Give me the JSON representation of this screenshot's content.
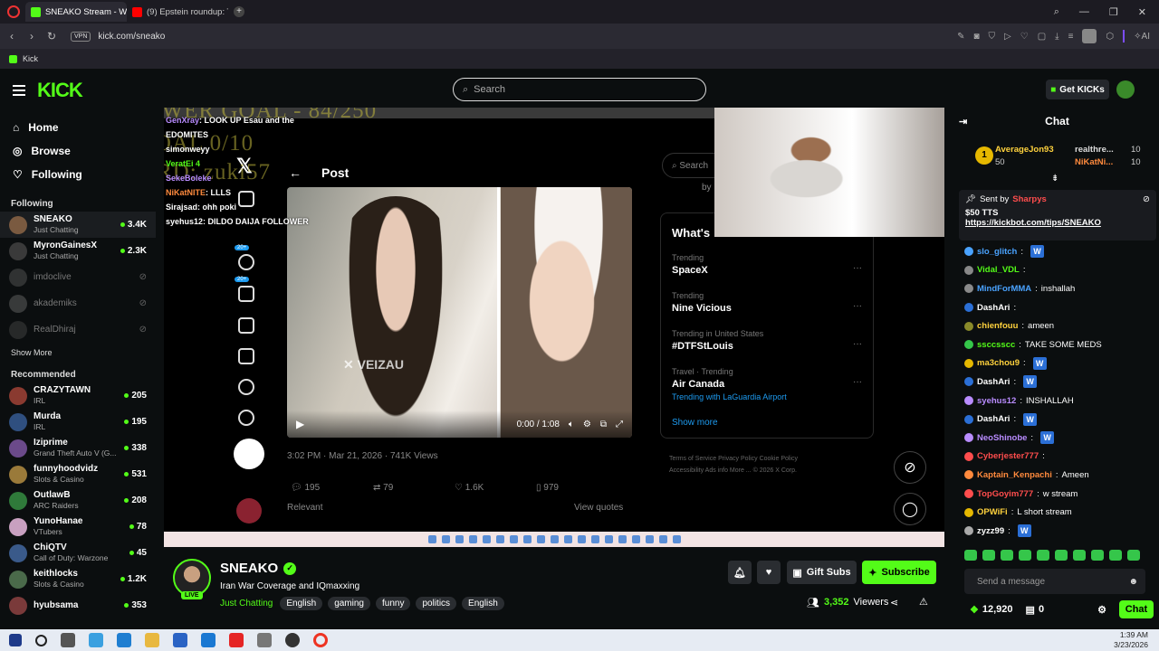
{
  "browser": {
    "tabs": [
      {
        "label": "SNEAKO Stream - Wa",
        "color": "#53fc18",
        "active": true
      },
      {
        "label": "(9) Epstein roundup: Trum",
        "color": "#ff0000",
        "active": false
      }
    ],
    "url": "kick.com/sneako",
    "vpn": "VPN",
    "bookmark": "Kick",
    "ai_label": "AI"
  },
  "header": {
    "logo": "KICK",
    "search_placeholder": "Search",
    "get_kicks": "Get KICKs"
  },
  "sidebar": {
    "nav": [
      {
        "label": "Home",
        "icon": "home-icon"
      },
      {
        "label": "Browse",
        "icon": "compass-icon"
      },
      {
        "label": "Following",
        "icon": "heart-icon"
      }
    ],
    "following_title": "Following",
    "following": [
      {
        "name": "SNEAKO",
        "sub": "Just Chatting",
        "viewers": "3.4K",
        "live": true
      },
      {
        "name": "MyronGainesX",
        "sub": "Just Chatting",
        "viewers": "2.3K",
        "live": true
      },
      {
        "name": "imdoclive",
        "sub": "",
        "viewers": "",
        "live": false
      },
      {
        "name": "akademiks",
        "sub": "",
        "viewers": "",
        "live": false
      },
      {
        "name": "RealDhiraj",
        "sub": "",
        "viewers": "",
        "live": false
      }
    ],
    "show_more": "Show More",
    "recommended_title": "Recommended",
    "recommended": [
      {
        "name": "CRAZYTAWN",
        "sub": "IRL",
        "viewers": "205"
      },
      {
        "name": "Murda",
        "sub": "IRL",
        "viewers": "195"
      },
      {
        "name": "Iziprime",
        "sub": "Grand Theft Auto V (G...",
        "viewers": "338"
      },
      {
        "name": "funnyhoodvidz",
        "sub": "Slots & Casino",
        "viewers": "531"
      },
      {
        "name": "OutlawB",
        "sub": "ARC Raiders",
        "viewers": "208"
      },
      {
        "name": "YunoHanae",
        "sub": "VTubers",
        "viewers": "78"
      },
      {
        "name": "ChiQTV",
        "sub": "Call of Duty: Warzone",
        "viewers": "45"
      },
      {
        "name": "keithlocks",
        "sub": "Slots & Casino",
        "viewers": "1.2K"
      },
      {
        "name": "hyubsama",
        "sub": "",
        "viewers": "353"
      }
    ]
  },
  "video": {
    "overlay": {
      "line1": "FOLLOWER GOAL - 84/250",
      "line2": "SUB GOAL 0/10",
      "line3": "DISCORD: zuki57"
    },
    "overlay_chat": [
      {
        "user": "GenXray",
        "text": "LOOK UP Esau and the",
        "color": "#b98cff"
      },
      {
        "user": "",
        "text": "EDOMITES",
        "color": "#fff"
      },
      {
        "user": "simonweyy",
        "text": "",
        "color": "#fff"
      },
      {
        "user": "VeratEi 4",
        "text": "",
        "color": "#53fc18"
      },
      {
        "user": "SekeBoleke",
        "text": "",
        "color": "#b98cff"
      },
      {
        "user": "NiKatNITE",
        "text": "LLLS",
        "color": "#ff8a3d"
      },
      {
        "user": "Sirajsad",
        "text": "ohh poki",
        "color": "#fff"
      },
      {
        "user": "syehus12",
        "text": "DILDO DAIJA FOLLOWER",
        "color": "#fff"
      }
    ],
    "post_title": "Post",
    "search_label": "Search",
    "x_search_sub": "by",
    "video_time": "0:00 / 1:08",
    "watermark": "VEIZAU",
    "post_meta": "3:02 PM · Mar 21, 2026 · 741K Views",
    "stats": {
      "replies": "195",
      "reposts": "79",
      "likes": "1.6K",
      "bookmarks": "979"
    },
    "relevant": "Relevant",
    "view_quotes": "View quotes",
    "whats_happening": "What's",
    "trends": [
      {
        "label": "Trending",
        "topic": "SpaceX",
        "extra": ""
      },
      {
        "label": "Trending",
        "topic": "Nine Vicious",
        "extra": ""
      },
      {
        "label": "Trending in United States",
        "topic": "#DTFStLouis",
        "extra": ""
      },
      {
        "label": "Travel · Trending",
        "topic": "Air Canada",
        "extra": "Trending with LaGuardia Airport"
      }
    ],
    "show_more": "Show more",
    "footer_links": "Terms of Service   Privacy Policy   Cookie Policy   Accessibility   Ads info   More ...   © 2026 X Corp.",
    "notif_badges": [
      "20+",
      "20+"
    ]
  },
  "stream": {
    "name": "SNEAKO",
    "live": "LIVE",
    "title": "Iran War Coverage and IQmaxxing",
    "category": "Just Chatting",
    "tags": [
      "English",
      "gaming",
      "funny",
      "politics",
      "English"
    ],
    "gift_subs": "Gift Subs",
    "subscribe": "Subscribe",
    "viewers": "3,352",
    "viewers_label": "Viewers"
  },
  "chat": {
    "title": "Chat",
    "leaderboard": [
      {
        "rank": "1",
        "user": "AverageJon93",
        "points": "50"
      },
      {
        "user": "realthre...",
        "points": "10"
      },
      {
        "user": "NiKatNi...",
        "points": "10"
      }
    ],
    "pinned": {
      "sent_by": "Sent by",
      "sender": "Sharpys",
      "amount": "$50 TTS",
      "link": "https://kickbot.com/tips/SNEAKO"
    },
    "messages": [
      {
        "user": "slo_glitch",
        "text": "",
        "color": "#4aa3ff",
        "emote": "W"
      },
      {
        "user": "Vidal_VDL",
        "text": "",
        "color": "#53fc18",
        "emote": ""
      },
      {
        "user": "MindForMMA",
        "text": "inshallah",
        "color": "#4aa3ff",
        "emote": ""
      },
      {
        "user": "DashAri",
        "text": "",
        "color": "#fff",
        "emote": ""
      },
      {
        "user": "chienfouu",
        "text": "ameen",
        "color": "#ffd23d",
        "emote": ""
      },
      {
        "user": "ssccsscc",
        "text": "TAKE SOME MEDS",
        "color": "#53fc18",
        "emote": ""
      },
      {
        "user": "ma3chou9",
        "text": "",
        "color": "#ffd23d",
        "emote": "W"
      },
      {
        "user": "DashAri",
        "text": "",
        "color": "#fff",
        "emote": "W"
      },
      {
        "user": "syehus12",
        "text": "INSHALLAH",
        "color": "#b98cff",
        "emote": ""
      },
      {
        "user": "DashAri",
        "text": "",
        "color": "#fff",
        "emote": "W"
      },
      {
        "user": "NeoShinobe",
        "text": "",
        "color": "#b98cff",
        "emote": "W"
      },
      {
        "user": "Cyberjester777",
        "text": "",
        "color": "#ff4d4d",
        "emote": ""
      },
      {
        "user": "Kaptain_Kenpachi",
        "text": "Ameen",
        "color": "#ff8a3d",
        "emote": ""
      },
      {
        "user": "TopGoyim777",
        "text": "w stream",
        "color": "#ff4d4d",
        "emote": ""
      },
      {
        "user": "OPWiFi",
        "text": "L short stream",
        "color": "#ffd23d",
        "emote": ""
      },
      {
        "user": "zyzz99",
        "text": "",
        "color": "#fff",
        "emote": "W"
      }
    ],
    "send_placeholder": "Send a message",
    "kicks": "12,920",
    "gifts": "0",
    "chat_button": "Chat"
  },
  "taskbar": {
    "time": "1:39 AM",
    "date": "3/23/2026"
  }
}
